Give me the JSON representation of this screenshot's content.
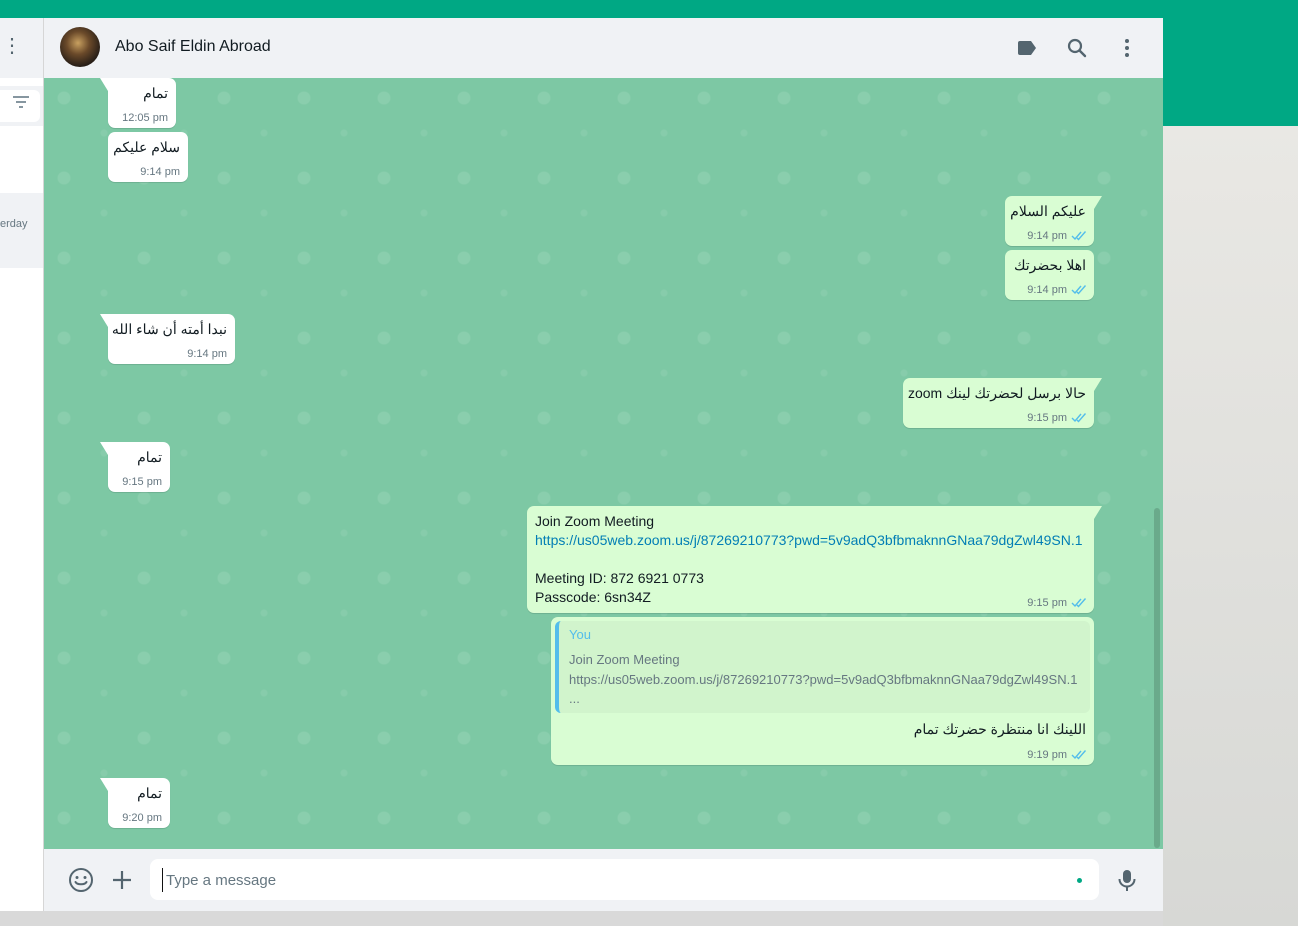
{
  "sidebar": {
    "chat_time": "erday"
  },
  "header": {
    "contact_name": "Abo Saif Eldin Abroad"
  },
  "messages": [
    {
      "text": "تمام",
      "time": "12:05 pm"
    },
    {
      "text": "سلام عليكم",
      "time": "9:14 pm"
    },
    {
      "text": "عليكم السلام",
      "time": "9:14 pm"
    },
    {
      "text": "اهلا بحضرتك",
      "time": "9:14 pm"
    },
    {
      "text": "نبدا أمته أن شاء الله",
      "time": "9:14 pm"
    },
    {
      "text": "حالا برسل لحضرتك لينك zoom",
      "time": "9:15 pm"
    },
    {
      "text": "تمام",
      "time": "9:15 pm"
    },
    {
      "line1": "Join Zoom Meeting",
      "link": "https://us05web.zoom.us/j/87269210773?pwd=5v9adQ3bfbmaknnGNaa79dgZwl49SN.1",
      "line3": "Meeting ID: 872 6921 0773",
      "line4": "Passcode: 6sn34Z",
      "time": "9:15 pm"
    },
    {
      "quote_author": "You",
      "quote_line1": "Join Zoom Meeting",
      "quote_line2": "https://us05web.zoom.us/j/87269210773?pwd=5v9adQ3bfbmaknnGNaa79dgZwl49SN.1",
      "quote_line3": "...",
      "text": "اللينك انا منتظرة حضرتك تمام",
      "time": "9:19 pm"
    },
    {
      "text": "تمام",
      "time": "9:20 pm"
    }
  ],
  "composer": {
    "placeholder": "Type a message"
  },
  "colors": {
    "accent": "#00a884",
    "outgoing_bubble": "#d9fdd3",
    "chat_background": "#7dc8a4",
    "read_tick": "#53bdeb"
  }
}
